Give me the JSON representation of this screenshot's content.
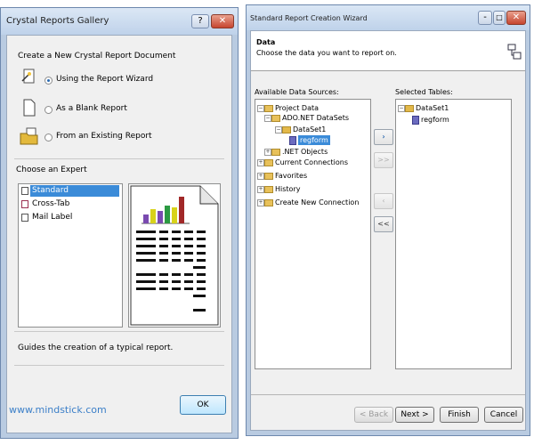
{
  "gallery": {
    "title": "Crystal Reports Gallery",
    "help_btn": "?",
    "close_btn": "✕",
    "create_section": "Create a New Crystal Report Document",
    "options": [
      {
        "label": "Using the Report Wizard",
        "selected": true
      },
      {
        "label": "As a Blank Report",
        "selected": false
      },
      {
        "label": "From an Existing Report",
        "selected": false
      }
    ],
    "expert_section": "Choose an Expert",
    "experts": [
      {
        "label": "Standard",
        "selected": true
      },
      {
        "label": "Cross-Tab",
        "selected": false
      },
      {
        "label": "Mail Label",
        "selected": false
      }
    ],
    "description": "Guides the creation of a typical report.",
    "watermark": "www.mindstick.com",
    "ok": "OK"
  },
  "wizard": {
    "title": "Standard Report Creation Wizard",
    "minimize_btn": "-",
    "maximize_btn": "□",
    "close_btn": "✕",
    "header_title": "Data",
    "header_subtitle": "Choose the data you want to report on.",
    "available_label": "Available Data Sources:",
    "selected_label": "Selected Tables:",
    "tree": {
      "project_data": "Project Data",
      "ado_datasets": "ADO.NET DataSets",
      "dataset1": "DataSet1",
      "regform": "regform",
      "net_objects": ".NET Objects",
      "current_connections": "Current Connections",
      "favorites": "Favorites",
      "history": "History",
      "create_connection": "Create New Connection"
    },
    "selected_tree": {
      "dataset1": "DataSet1",
      "regform": "regform"
    },
    "move_buttons": {
      "add": "›",
      "add_all": ">>",
      "remove": "‹",
      "remove_all": "<<"
    },
    "footer": {
      "back": "< Back",
      "next": "Next >",
      "finish": "Finish",
      "cancel": "Cancel"
    }
  }
}
